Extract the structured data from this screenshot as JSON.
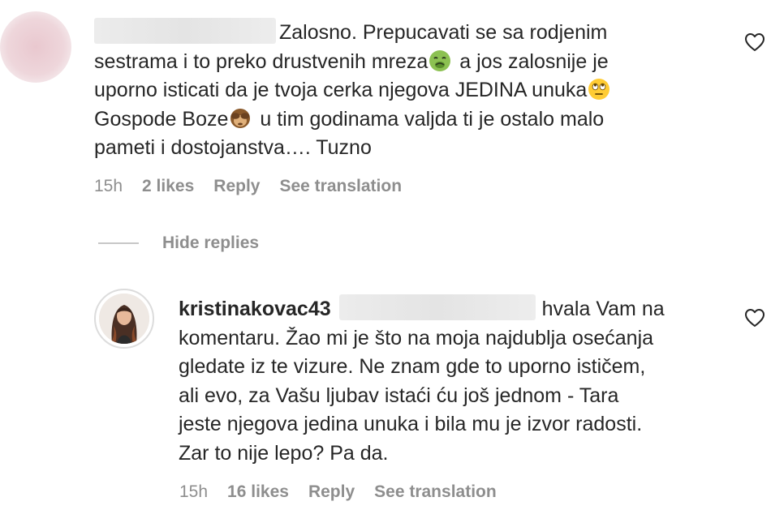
{
  "comment": {
    "text_line1": "Zalosno. Prepucavati se sa rodjenim",
    "text_line2a": "sestrama i to preko drustvenih mreza",
    "text_line2b": " a jos zalosnije je",
    "text_line3a": "uporno isticati da je tvoja cerka njegova JEDINA unuka",
    "text_line4a": "Gospode Boze",
    "text_line4b": " u tim godinama valjda ti je ostalo malo",
    "text_line5": "pameti i dostojanstva…. Tuzno",
    "meta": {
      "time": "15h",
      "likes": "2 likes",
      "reply": "Reply",
      "translation": "See translation"
    },
    "emojis": [
      "nauseated-face",
      "face-with-rolling-eyes",
      "see-no-evil-monkey"
    ]
  },
  "replies_toggle": {
    "label": "Hide replies"
  },
  "reply": {
    "username": "kristinakovac43",
    "text_line1": "hvala Vam na",
    "text_line2": "komentaru. Žao mi je što na moja najdublja osećanja",
    "text_line3": "gledate iz te vizure. Ne znam gde to uporno ističem,",
    "text_line4": "ali evo, za Vašu ljubav istaći ću još jednom - Tara",
    "text_line5": "jeste njegova jedina unuka i bila mu je izvor radosti.",
    "text_line6": "Zar to nije lepo? Pa da.",
    "meta": {
      "time": "15h",
      "likes": "16 likes",
      "reply": "Reply",
      "translation": "See translation"
    }
  },
  "icons": {
    "like": "heart-outline-icon"
  },
  "colors": {
    "text": "#262626",
    "secondary": "#8e8e8e",
    "divider": "#c7c7c7"
  }
}
